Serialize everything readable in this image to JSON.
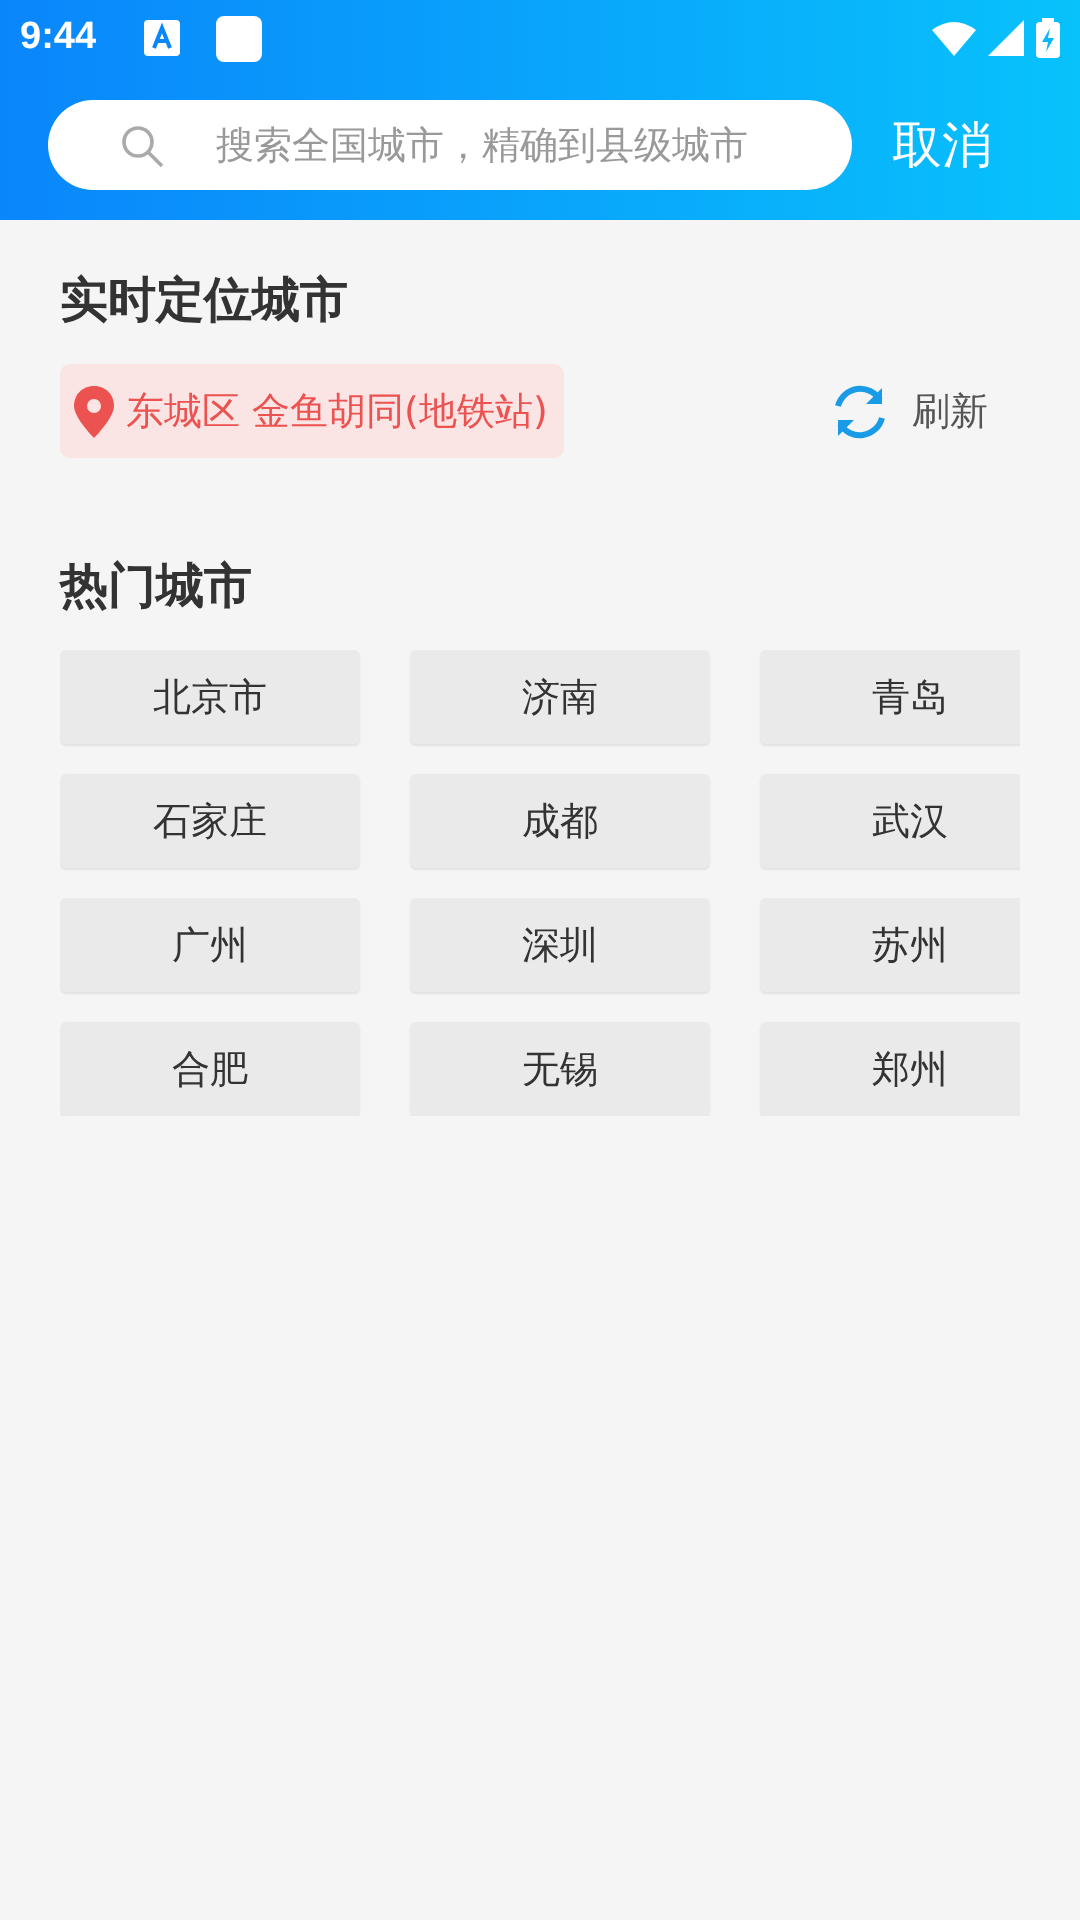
{
  "status_bar": {
    "time": "9:44"
  },
  "search": {
    "placeholder": "搜索全国城市，精确到县级城市",
    "cancel": "取消"
  },
  "location": {
    "title": "实时定位城市",
    "address": "东城区 金鱼胡同(地铁站)",
    "refresh": "刷新"
  },
  "hot": {
    "title": "热门城市",
    "cities": [
      "北京市",
      "济南",
      "青岛",
      "石家庄",
      "成都",
      "武汉",
      "广州",
      "深圳",
      "苏州",
      "合肥",
      "无锡",
      "郑州"
    ]
  }
}
